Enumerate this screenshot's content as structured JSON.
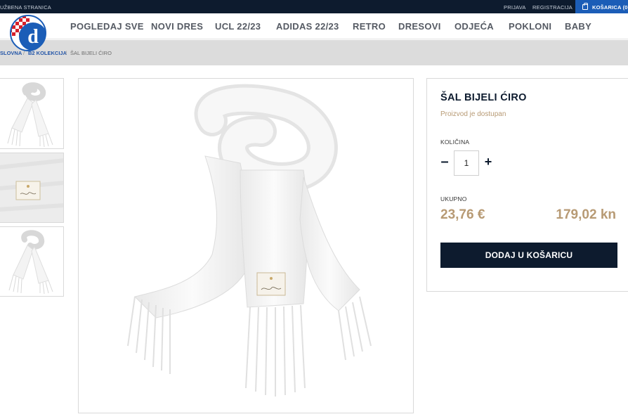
{
  "topbar": {
    "official_label": "UŽBENA STRANICA",
    "login_label": "PRIJAVA",
    "register_label": "REGISTRACIJA",
    "cart_label": "KOŠARICA (0)"
  },
  "nav": {
    "items": [
      {
        "label": "POGLEDAJ SVE"
      },
      {
        "label": "NOVI DRES"
      },
      {
        "label": "UCL 22/23"
      },
      {
        "label": "ADIDAS 22/23"
      },
      {
        "label": "RETRO"
      },
      {
        "label": "DRESOVI"
      },
      {
        "label": "ODJEĆA"
      },
      {
        "label": "POKLONI"
      },
      {
        "label": "BABY"
      }
    ]
  },
  "breadcrumb": {
    "home": "SLOVNA",
    "category": "B2 KOLEKCIJA",
    "current": "ŠAL BIJELI ĆIRO",
    "separator": "/"
  },
  "product": {
    "title": "ŠAL BIJELI ĆIRO",
    "availability": "Proizvod je dostupan",
    "quantity_label": "KOLIČINA",
    "quantity_value": "1",
    "decrement_symbol": "–",
    "increment_symbol": "+",
    "total_label": "UKUPNO",
    "price_eur": "23,76 €",
    "price_kn": "179,02 kn",
    "add_to_cart_label": "DODAJ U KOŠARICU"
  },
  "colors": {
    "navy": "#0d1b2e",
    "accent_blue": "#1b5db7",
    "gold": "#b79a74",
    "breadcrumb_bg": "#dcdcdc"
  },
  "icons": {
    "cart": "shopping-bag-icon",
    "logo": "dinamo-crest-logo"
  }
}
